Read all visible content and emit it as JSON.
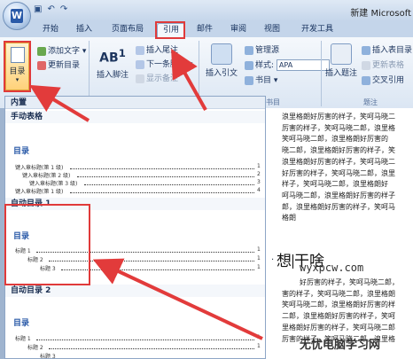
{
  "window": {
    "doc_title": "新建 Microsoft"
  },
  "qat": {
    "undo_glyph": "↶",
    "redo_glyph": "↷",
    "save_glyph": "▣"
  },
  "tabs": [
    {
      "label": "开始"
    },
    {
      "label": "插入"
    },
    {
      "label": "页面布局"
    },
    {
      "label": "引用"
    },
    {
      "label": "邮件"
    },
    {
      "label": "审阅"
    },
    {
      "label": "视图"
    },
    {
      "label": "开发工具"
    }
  ],
  "ribbon": {
    "toc_label": "目录",
    "add_text": "添加文字",
    "update_toc": "更新目录",
    "insert_footnote": "插入脚注",
    "insert_endnote": "插入尾注",
    "next_footnote": "下一条脚注",
    "show_notes": "显示备注",
    "ab_label": "AB",
    "ab_sup": "1",
    "insert_citation": "插入引文",
    "manage_sources": "管理源",
    "style_label": "样式:",
    "style_value": "APA",
    "bibliography": "书目",
    "group_citations": "书目",
    "insert_caption": "插入题注",
    "insert_toc_figures": "插入表目录",
    "update_table": "更新表格",
    "cross_ref": "交叉引用",
    "group_captions": "题注"
  },
  "gallery": {
    "builtin": "内置",
    "manual_table": "手动表格",
    "mulu": "目录",
    "manual_lines": [
      {
        "text": "键入章标题(第 1 级)",
        "page": "1"
      },
      {
        "text": "键入章标题(第 2 级)",
        "page": "2"
      },
      {
        "text": "键入章标题(第 3 级)",
        "page": "3"
      },
      {
        "text": "键入章标题(第 1 级)",
        "page": "4"
      }
    ],
    "auto1": "自动目录 1",
    "auto1_lines": [
      {
        "text": "标题 1",
        "page": "1"
      },
      {
        "text": "标题 2",
        "page": "1"
      },
      {
        "text": "标题 3",
        "page": "1"
      }
    ],
    "auto2": "自动目录 2",
    "auto2_lines": [
      {
        "text": "标题 1",
        "page": "1"
      },
      {
        "text": "标题 2",
        "page": "1"
      },
      {
        "text": "标题 3",
        "page": "1"
      }
    ]
  },
  "document": {
    "paragraph1": [
      "浪里格朗好厉害的样子，笑呵马晓二",
      "厉害的样子，笑呵马晓二郎，浪里格",
      "笑呵马晓二郎，浪里格朗好厉害的",
      "晓二郎，浪里格朗好厉害的样子，笑",
      "浪里格朗好厉害的样子，笑呵马晓二",
      "好厉害的样子，笑呵马晓二郎，浪里",
      "样子，笑呵马晓二郎，浪里格朗好",
      "呵马晓二郎，浪里格朗好厉害的样子",
      "郎，浪里格朗好厉害的样子，笑呵马",
      "格朗"
    ],
    "heading_before": "想",
    "heading_after": "干啥",
    "paragraph2": [
      "好厉害的样子，笑呵马晓二郎，",
      "害的样子，笑呵马晓二郎，浪里格朗",
      "笑呵马晓二郎，浪里格朗好厉害的样",
      "二郎，浪里格朗好厉害的样子，笑呵",
      "里格朗好厉害的样子，笑呵马晓二郎",
      "厉害的样子，笑呵马晓二郎，浪里格"
    ],
    "watermark": "wyxpcw.com",
    "watermark2": "无忧电脑学习网"
  }
}
